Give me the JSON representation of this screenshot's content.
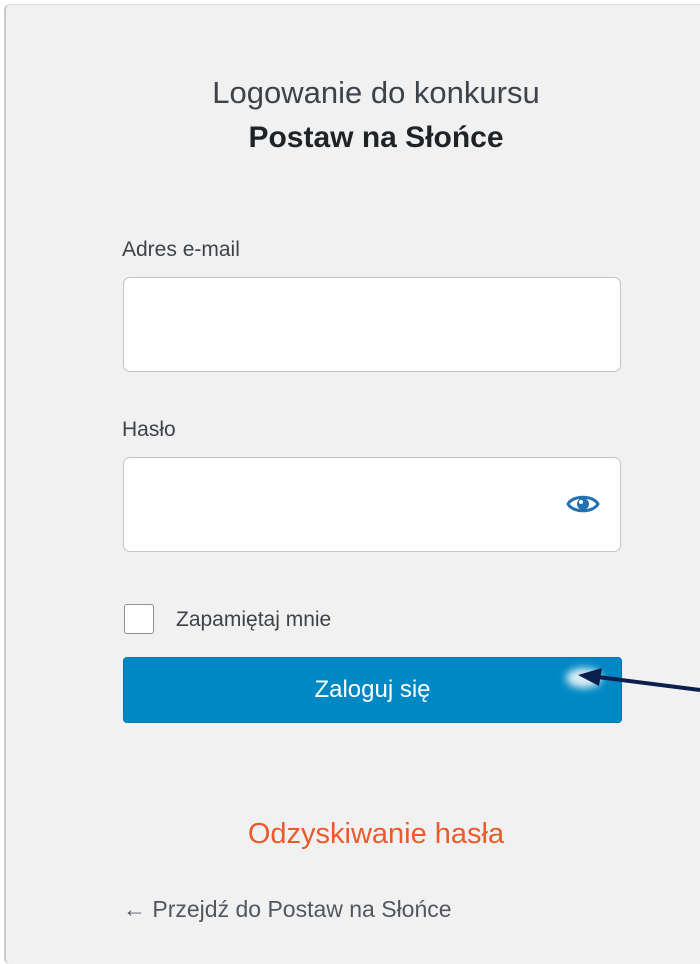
{
  "login": {
    "title_line1": "Logowanie do konkursu",
    "title_line2": "Postaw na Słońce",
    "email_label": "Adres e-mail",
    "email_value": "",
    "password_label": "Hasło",
    "password_value": "",
    "remember_label": "Zapamiętaj mnie",
    "remember_checked": false,
    "submit_label": "Zaloguj się",
    "recover_link": "Odzyskiwanie hasła",
    "back_link": "← Przejdź do Postaw na Słońce"
  },
  "icons": {
    "password_toggle": "eye-icon",
    "annotation": "arrow-pointer"
  },
  "colors": {
    "panel_background": "#f1f1f1",
    "button_background": "#0088c4",
    "button_text": "#ffffff",
    "recover_link": "#ec5a2c",
    "eye_icon": "#2271b1",
    "annotation_arrow": "#0b1f4d"
  }
}
